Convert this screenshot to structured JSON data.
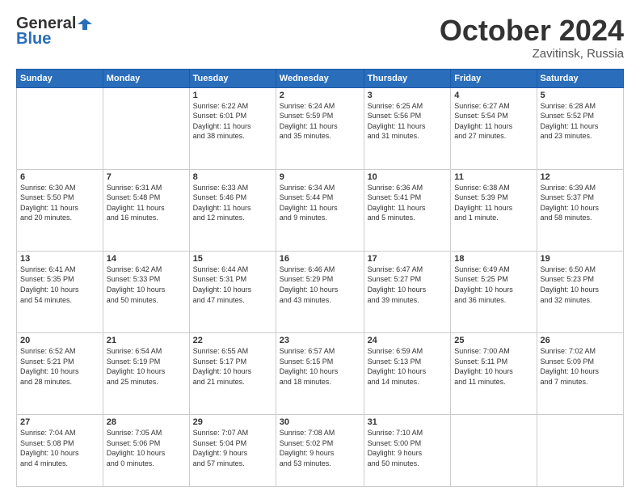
{
  "header": {
    "logo_general": "General",
    "logo_blue": "Blue",
    "month": "October 2024",
    "location": "Zavitinsk, Russia"
  },
  "weekdays": [
    "Sunday",
    "Monday",
    "Tuesday",
    "Wednesday",
    "Thursday",
    "Friday",
    "Saturday"
  ],
  "weeks": [
    [
      {
        "day": "",
        "info": ""
      },
      {
        "day": "",
        "info": ""
      },
      {
        "day": "1",
        "info": "Sunrise: 6:22 AM\nSunset: 6:01 PM\nDaylight: 11 hours\nand 38 minutes."
      },
      {
        "day": "2",
        "info": "Sunrise: 6:24 AM\nSunset: 5:59 PM\nDaylight: 11 hours\nand 35 minutes."
      },
      {
        "day": "3",
        "info": "Sunrise: 6:25 AM\nSunset: 5:56 PM\nDaylight: 11 hours\nand 31 minutes."
      },
      {
        "day": "4",
        "info": "Sunrise: 6:27 AM\nSunset: 5:54 PM\nDaylight: 11 hours\nand 27 minutes."
      },
      {
        "day": "5",
        "info": "Sunrise: 6:28 AM\nSunset: 5:52 PM\nDaylight: 11 hours\nand 23 minutes."
      }
    ],
    [
      {
        "day": "6",
        "info": "Sunrise: 6:30 AM\nSunset: 5:50 PM\nDaylight: 11 hours\nand 20 minutes."
      },
      {
        "day": "7",
        "info": "Sunrise: 6:31 AM\nSunset: 5:48 PM\nDaylight: 11 hours\nand 16 minutes."
      },
      {
        "day": "8",
        "info": "Sunrise: 6:33 AM\nSunset: 5:46 PM\nDaylight: 11 hours\nand 12 minutes."
      },
      {
        "day": "9",
        "info": "Sunrise: 6:34 AM\nSunset: 5:44 PM\nDaylight: 11 hours\nand 9 minutes."
      },
      {
        "day": "10",
        "info": "Sunrise: 6:36 AM\nSunset: 5:41 PM\nDaylight: 11 hours\nand 5 minutes."
      },
      {
        "day": "11",
        "info": "Sunrise: 6:38 AM\nSunset: 5:39 PM\nDaylight: 11 hours\nand 1 minute."
      },
      {
        "day": "12",
        "info": "Sunrise: 6:39 AM\nSunset: 5:37 PM\nDaylight: 10 hours\nand 58 minutes."
      }
    ],
    [
      {
        "day": "13",
        "info": "Sunrise: 6:41 AM\nSunset: 5:35 PM\nDaylight: 10 hours\nand 54 minutes."
      },
      {
        "day": "14",
        "info": "Sunrise: 6:42 AM\nSunset: 5:33 PM\nDaylight: 10 hours\nand 50 minutes."
      },
      {
        "day": "15",
        "info": "Sunrise: 6:44 AM\nSunset: 5:31 PM\nDaylight: 10 hours\nand 47 minutes."
      },
      {
        "day": "16",
        "info": "Sunrise: 6:46 AM\nSunset: 5:29 PM\nDaylight: 10 hours\nand 43 minutes."
      },
      {
        "day": "17",
        "info": "Sunrise: 6:47 AM\nSunset: 5:27 PM\nDaylight: 10 hours\nand 39 minutes."
      },
      {
        "day": "18",
        "info": "Sunrise: 6:49 AM\nSunset: 5:25 PM\nDaylight: 10 hours\nand 36 minutes."
      },
      {
        "day": "19",
        "info": "Sunrise: 6:50 AM\nSunset: 5:23 PM\nDaylight: 10 hours\nand 32 minutes."
      }
    ],
    [
      {
        "day": "20",
        "info": "Sunrise: 6:52 AM\nSunset: 5:21 PM\nDaylight: 10 hours\nand 28 minutes."
      },
      {
        "day": "21",
        "info": "Sunrise: 6:54 AM\nSunset: 5:19 PM\nDaylight: 10 hours\nand 25 minutes."
      },
      {
        "day": "22",
        "info": "Sunrise: 6:55 AM\nSunset: 5:17 PM\nDaylight: 10 hours\nand 21 minutes."
      },
      {
        "day": "23",
        "info": "Sunrise: 6:57 AM\nSunset: 5:15 PM\nDaylight: 10 hours\nand 18 minutes."
      },
      {
        "day": "24",
        "info": "Sunrise: 6:59 AM\nSunset: 5:13 PM\nDaylight: 10 hours\nand 14 minutes."
      },
      {
        "day": "25",
        "info": "Sunrise: 7:00 AM\nSunset: 5:11 PM\nDaylight: 10 hours\nand 11 minutes."
      },
      {
        "day": "26",
        "info": "Sunrise: 7:02 AM\nSunset: 5:09 PM\nDaylight: 10 hours\nand 7 minutes."
      }
    ],
    [
      {
        "day": "27",
        "info": "Sunrise: 7:04 AM\nSunset: 5:08 PM\nDaylight: 10 hours\nand 4 minutes."
      },
      {
        "day": "28",
        "info": "Sunrise: 7:05 AM\nSunset: 5:06 PM\nDaylight: 10 hours\nand 0 minutes."
      },
      {
        "day": "29",
        "info": "Sunrise: 7:07 AM\nSunset: 5:04 PM\nDaylight: 9 hours\nand 57 minutes."
      },
      {
        "day": "30",
        "info": "Sunrise: 7:08 AM\nSunset: 5:02 PM\nDaylight: 9 hours\nand 53 minutes."
      },
      {
        "day": "31",
        "info": "Sunrise: 7:10 AM\nSunset: 5:00 PM\nDaylight: 9 hours\nand 50 minutes."
      },
      {
        "day": "",
        "info": ""
      },
      {
        "day": "",
        "info": ""
      }
    ]
  ]
}
